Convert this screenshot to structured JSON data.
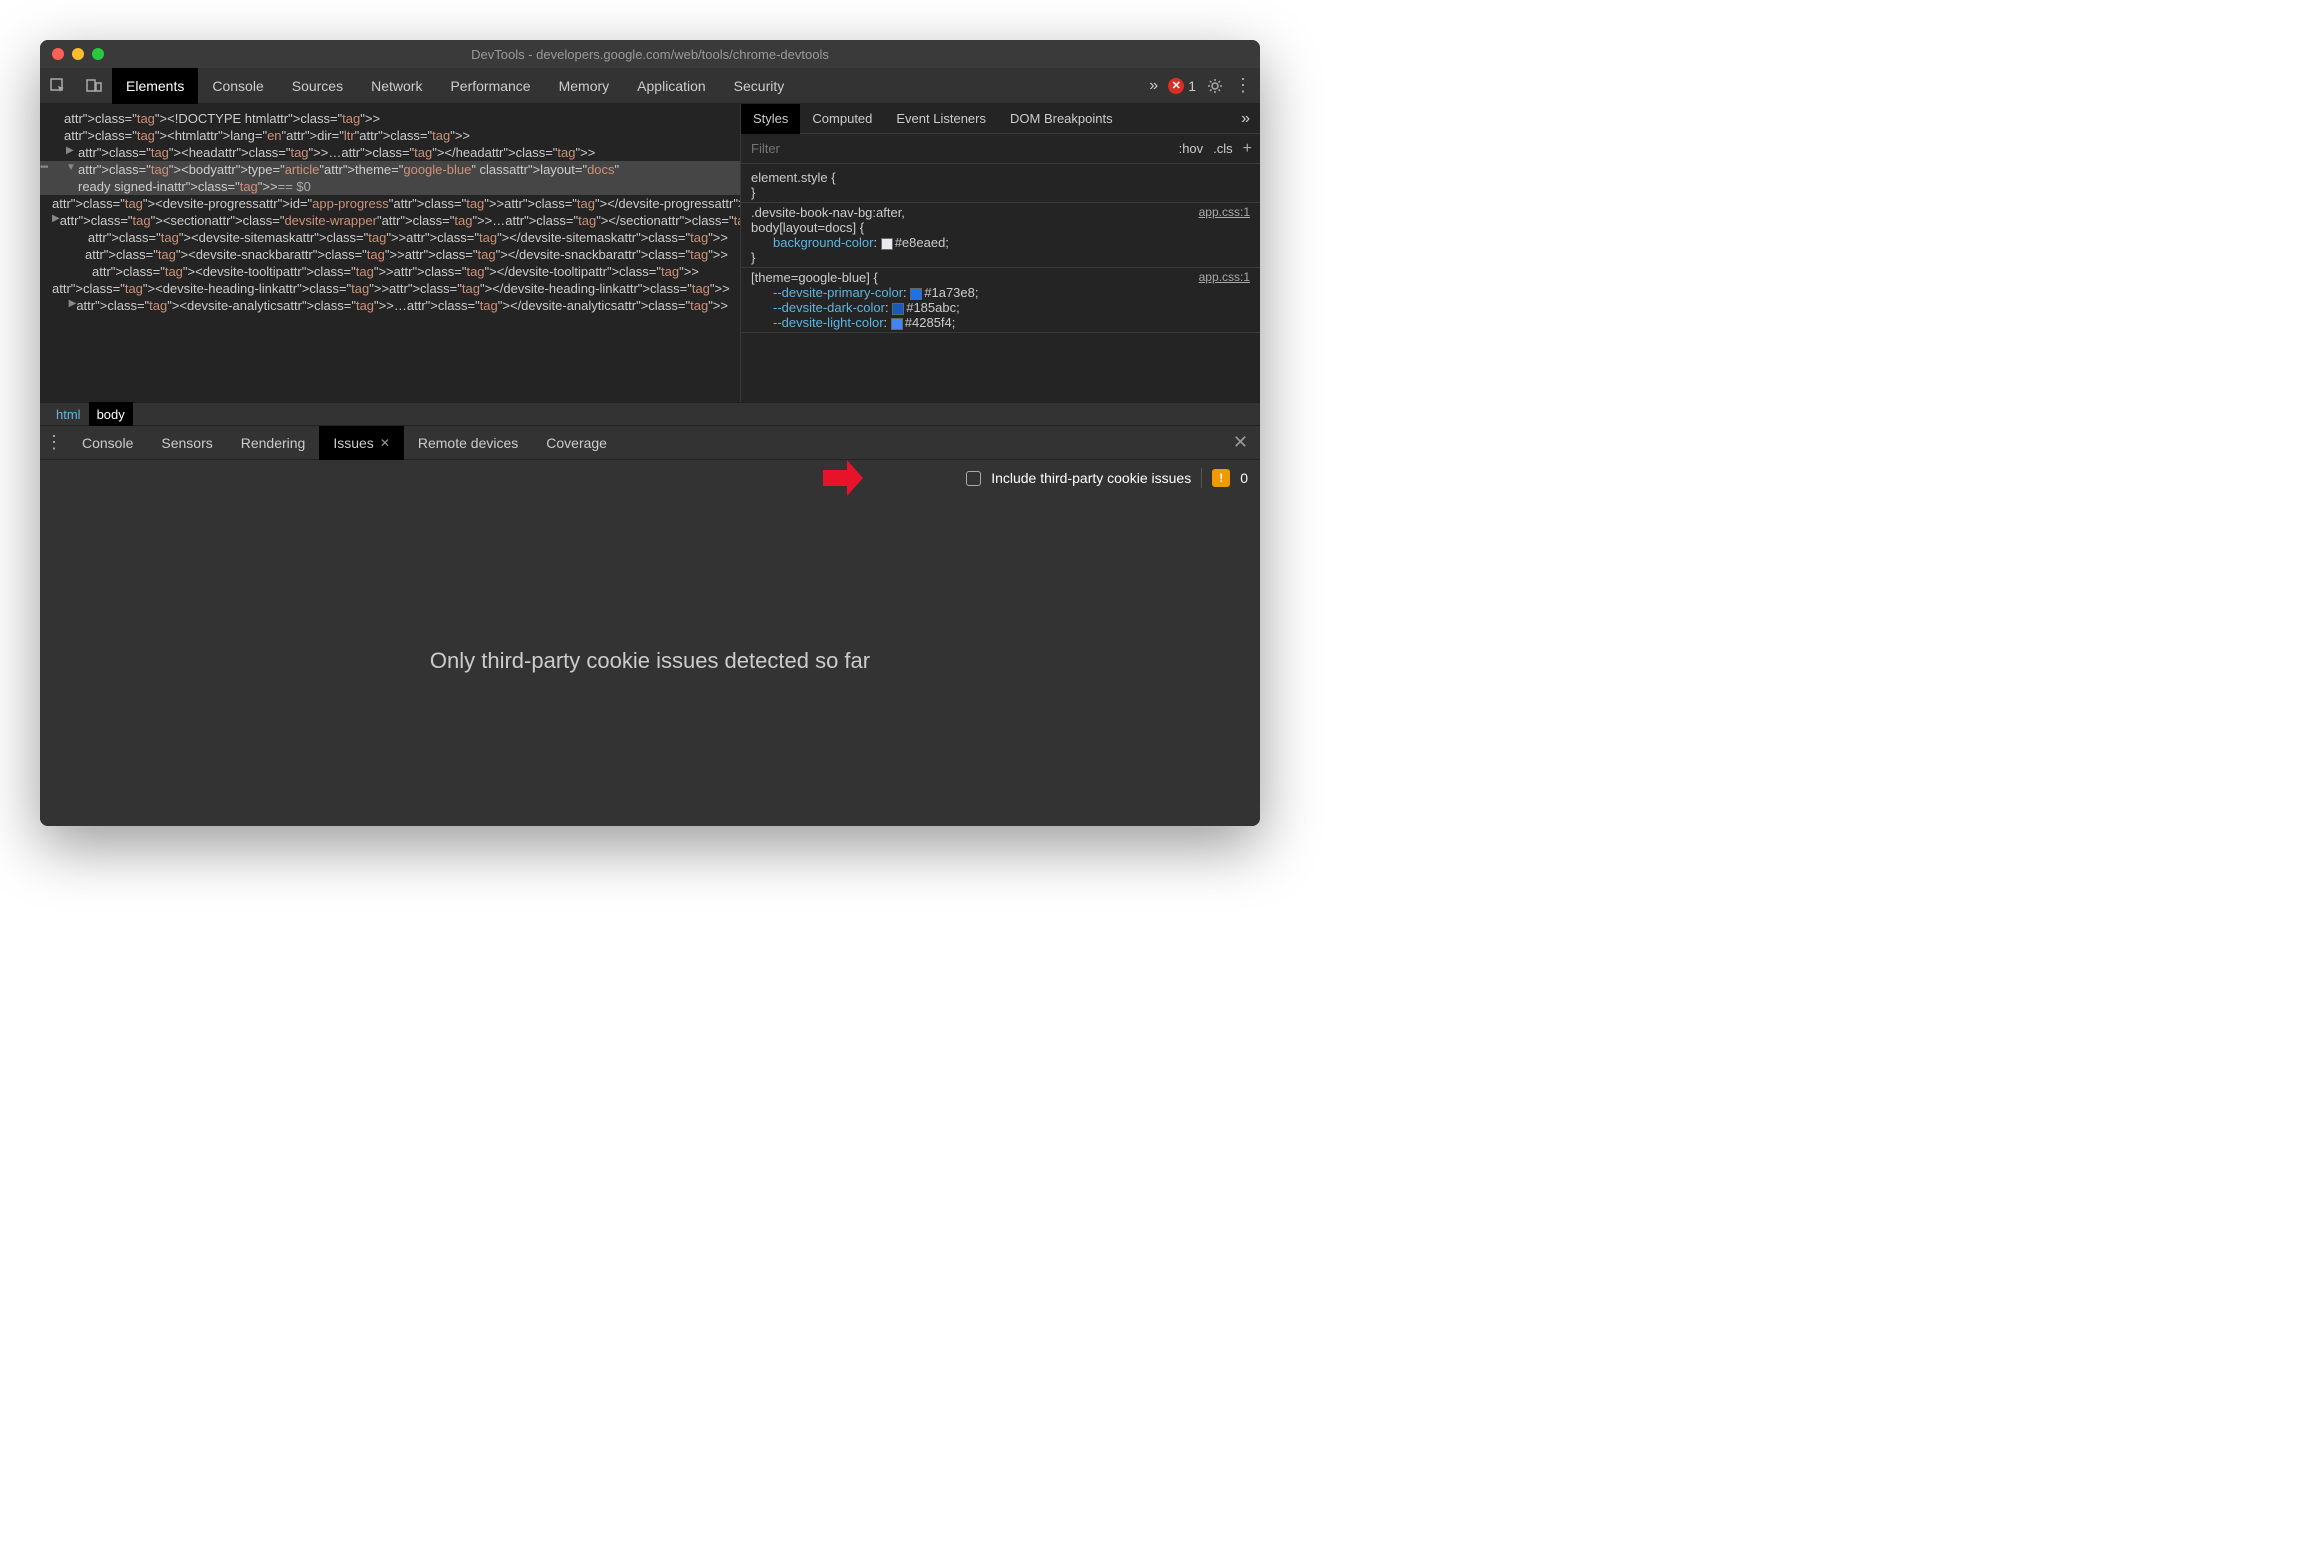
{
  "window": {
    "title": "DevTools - developers.google.com/web/tools/chrome-devtools"
  },
  "toolbar": {
    "tabs": [
      "Elements",
      "Console",
      "Sources",
      "Network",
      "Performance",
      "Memory",
      "Application",
      "Security"
    ],
    "activeTab": 0,
    "errorCount": "1"
  },
  "dom": {
    "lines": [
      {
        "ind": 0,
        "arrow": "",
        "html": "<!DOCTYPE html>"
      },
      {
        "ind": 0,
        "arrow": "",
        "html": "<html lang=\"en\" dir=\"ltr\">"
      },
      {
        "ind": 1,
        "arrow": "▶",
        "html": "<head>…</head>"
      },
      {
        "ind": 1,
        "arrow": "▼",
        "html": "<body type=\"article\" theme=\"google-blue\" class layout=\"docs\"",
        "sel": true,
        "dots": true
      },
      {
        "ind": 1,
        "arrow": "",
        "html": "ready signed-in> == $0",
        "sel": true
      },
      {
        "ind": 2,
        "arrow": "",
        "html": "<devsite-progress id=\"app-progress\"></devsite-progress>"
      },
      {
        "ind": 2,
        "arrow": "▶",
        "html": "<section class=\"devsite-wrapper\">…</section>"
      },
      {
        "ind": 2,
        "arrow": "",
        "html": "<devsite-sitemask></devsite-sitemask>"
      },
      {
        "ind": 2,
        "arrow": "",
        "html": "<devsite-snackbar></devsite-snackbar>"
      },
      {
        "ind": 2,
        "arrow": "",
        "html": "<devsite-tooltip></devsite-tooltip>"
      },
      {
        "ind": 2,
        "arrow": "",
        "html": "<devsite-heading-link></devsite-heading-link>"
      },
      {
        "ind": 2,
        "arrow": "▶",
        "html": "<devsite-analytics>…</devsite-analytics>"
      }
    ]
  },
  "breadcrumb": {
    "items": [
      "html",
      "body"
    ],
    "active": 1
  },
  "styles": {
    "tabs": [
      "Styles",
      "Computed",
      "Event Listeners",
      "DOM Breakpoints"
    ],
    "activeTab": 0,
    "filterPlaceholder": "Filter",
    "hov": ":hov",
    "cls": ".cls",
    "rules": [
      {
        "selector": "element.style {",
        "link": "",
        "lines": [],
        "close": "}"
      },
      {
        "selector": ".devsite-book-nav-bg:after,",
        "selector2": "body[layout=docs] {",
        "link": "app.css:1",
        "lines": [
          {
            "prop": "background-color",
            "swatch": "#e8eaed",
            "val": "#e8eaed;"
          }
        ],
        "close": "}"
      },
      {
        "selector": "[theme=google-blue] {",
        "link": "app.css:1",
        "lines": [
          {
            "prop": "--devsite-primary-color",
            "swatch": "#1a73e8",
            "val": "#1a73e8;"
          },
          {
            "prop": "--devsite-dark-color",
            "swatch": "#185abc",
            "val": "#185abc;"
          },
          {
            "prop": "--devsite-light-color",
            "swatch": "#4285f4",
            "val": "#4285f4;"
          }
        ],
        "close": ""
      }
    ]
  },
  "drawer": {
    "tabs": [
      {
        "label": "Console",
        "active": false,
        "closable": false
      },
      {
        "label": "Sensors",
        "active": false,
        "closable": false
      },
      {
        "label": "Rendering",
        "active": false,
        "closable": false
      },
      {
        "label": "Issues",
        "active": true,
        "closable": true
      },
      {
        "label": "Remote devices",
        "active": false,
        "closable": false
      },
      {
        "label": "Coverage",
        "active": false,
        "closable": false
      }
    ]
  },
  "issues": {
    "checkboxLabel": "Include third-party cookie issues",
    "count": "0",
    "body": "Only third-party cookie issues detected so far"
  }
}
